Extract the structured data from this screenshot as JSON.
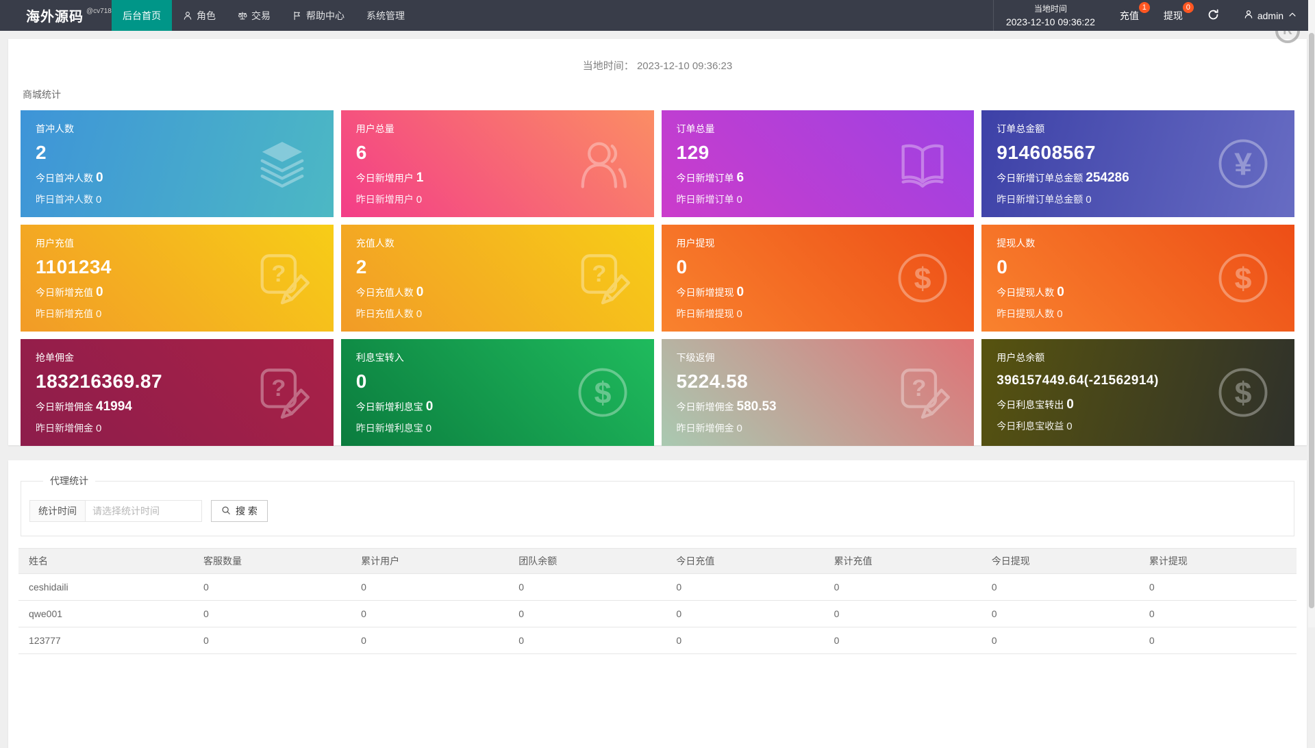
{
  "navbar": {
    "logo": "海外源码",
    "logo_sub": "@cv718",
    "items": [
      {
        "id": "home",
        "label": "后台首页",
        "icon": null,
        "active": true
      },
      {
        "id": "roles",
        "label": "角色",
        "icon": "user",
        "active": false
      },
      {
        "id": "trade",
        "label": "交易",
        "icon": "scales",
        "active": false
      },
      {
        "id": "help",
        "label": "帮助中心",
        "icon": "flag",
        "active": false
      },
      {
        "id": "system",
        "label": "系统管理",
        "icon": null,
        "active": false
      }
    ],
    "local_time_label": "当地时间",
    "local_time_value": "2023-12-10 09:36:22",
    "recharge_label": "充值",
    "recharge_badge": "1",
    "withdraw_label": "提现",
    "withdraw_badge": "0",
    "username": "admin",
    "badge_color": "#ff5722",
    "active_tab_color": "#009688",
    "watermark_letter": "R"
  },
  "main": {
    "local_time_label": "当地时间：",
    "local_time_value": "2023-12-10 09:36:23",
    "section_title": "商城统计",
    "cards": [
      {
        "id": "first-charge-users",
        "title": "首冲人数",
        "value": "2",
        "line2_label": "今日首冲人数",
        "line2_value": "0",
        "line3_label": "昨日首冲人数",
        "line3_value": "0",
        "icon": "layers",
        "gradient": "linear-gradient(105deg,#3e94d8 0%,#4cb8c4 100%)"
      },
      {
        "id": "total-users",
        "title": "用户总量",
        "value": "6",
        "line2_label": "今日新增用户",
        "line2_value": "1",
        "line3_label": "昨日新增用户",
        "line3_value": "0",
        "icon": "user-big",
        "gradient": "linear-gradient(225deg,#fb8d64 0%,#f33d88 100%)"
      },
      {
        "id": "total-orders",
        "title": "订单总量",
        "value": "129",
        "line2_label": "今日新增订单",
        "line2_value": "6",
        "line3_label": "昨日新增订单",
        "line3_value": "0",
        "icon": "book",
        "gradient": "linear-gradient(45deg,#cb3ccb 0%,#9d42e3 100%)"
      },
      {
        "id": "order-amount",
        "title": "订单总金额",
        "value": "914608567",
        "line2_label": "今日新增订单总金额",
        "line2_value": "254286",
        "line3_label": "昨日新增订单总金额",
        "line3_value": "0",
        "icon": "yen",
        "gradient": "linear-gradient(105deg,#3d41a7 0%,#676cc3 100%)"
      },
      {
        "id": "user-recharge",
        "title": "用户充值",
        "value": "1101234",
        "line2_label": "今日新增充值",
        "line2_value": "0",
        "line3_label": "昨日新增充值",
        "line3_value": "0",
        "icon": "doc",
        "gradient": "linear-gradient(45deg,#f29b27 0%,#f7cd17 100%)"
      },
      {
        "id": "recharge-users",
        "title": "充值人数",
        "value": "2",
        "line2_label": "今日充值人数",
        "line2_value": "0",
        "line3_label": "昨日充值人数",
        "line3_value": "0",
        "icon": "doc",
        "gradient": "linear-gradient(45deg,#f29b27 0%,#f7cd17 100%)"
      },
      {
        "id": "user-withdraw",
        "title": "用户提现",
        "value": "0",
        "line2_label": "今日新增提现",
        "line2_value": "0",
        "line3_label": "昨日新增提现",
        "line3_value": "0",
        "icon": "dollar",
        "gradient": "linear-gradient(45deg,#f9822e 0%,#ed4e16 100%)"
      },
      {
        "id": "withdraw-users",
        "title": "提现人数",
        "value": "0",
        "line2_label": "今日提现人数",
        "line2_value": "0",
        "line3_label": "昨日提现人数",
        "line3_value": "0",
        "icon": "dollar",
        "gradient": "linear-gradient(45deg,#f9822e 0%,#ed4e16 100%)"
      },
      {
        "id": "order-commission",
        "title": "抢单佣金",
        "value": "183216369.87",
        "line2_label": "今日新增佣金",
        "line2_value": "41994",
        "line3_label": "昨日新增佣金",
        "line3_value": "0",
        "icon": "doc",
        "gradient": "linear-gradient(45deg,#8d1d4b 0%,#a92147 100%)"
      },
      {
        "id": "interest-in",
        "title": "利息宝转入",
        "value": "0",
        "line2_label": "今日新增利息宝",
        "line2_value": "0",
        "line3_label": "昨日新增利息宝",
        "line3_value": "0",
        "icon": "dollar",
        "gradient": "linear-gradient(45deg,#0b7c3e 0%,#1fbb5d 100%)"
      },
      {
        "id": "sub-rebate",
        "title": "下级返佣",
        "value": "5224.58",
        "line2_label": "今日新增佣金",
        "line2_value": "580.53",
        "line3_label": "昨日新增佣金",
        "line3_value": "0",
        "icon": "doc",
        "gradient": "linear-gradient(45deg,#a9c9b1 0%,#de7477 100%)"
      },
      {
        "id": "user-balance",
        "title": "用户总余额",
        "value": "396157449.64(-21562914)",
        "value_small": true,
        "line2_label": "今日利息宝转出",
        "line2_value": "0",
        "line3_label": "今日利息宝收益",
        "line3_value": "0",
        "icon": "dollar",
        "gradient": "linear-gradient(105deg,#57530f 0%,#2f312b 100%)"
      }
    ]
  },
  "agent_section": {
    "legend": "代理统计",
    "filter_label": "统计时间",
    "filter_placeholder": "请选择统计时间",
    "search_label": "搜 索",
    "table": {
      "headers": [
        "姓名",
        "客服数量",
        "累计用户",
        "团队余额",
        "今日充值",
        "累计充值",
        "今日提现",
        "累计提现"
      ],
      "rows": [
        [
          "ceshidaili",
          "0",
          "0",
          "0",
          "0",
          "0",
          "0",
          "0"
        ],
        [
          "qwe001",
          "0",
          "0",
          "0",
          "0",
          "0",
          "0",
          "0"
        ],
        [
          "123777",
          "0",
          "0",
          "0",
          "0",
          "0",
          "0",
          "0"
        ]
      ]
    }
  }
}
